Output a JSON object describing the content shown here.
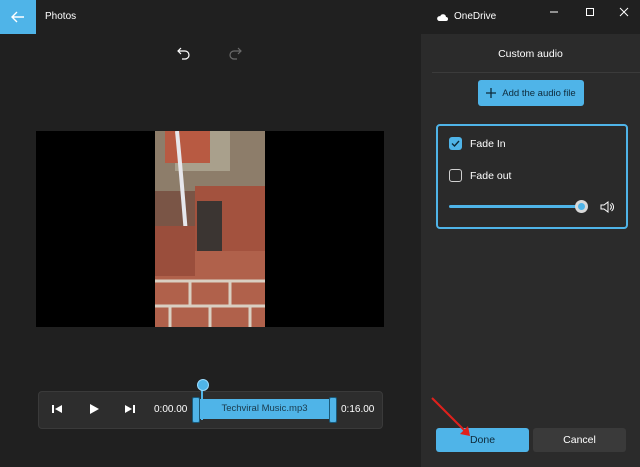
{
  "app": {
    "title": "Photos"
  },
  "titlebar": {
    "back_icon": "arrow-left-icon",
    "cloud_icon": "cloud-icon",
    "cloud_label": "OneDrive",
    "window_controls": [
      "minimize-icon",
      "maximize-icon",
      "close-icon"
    ]
  },
  "toolbar": {
    "undo_icon": "undo-icon",
    "redo_icon": "redo-icon"
  },
  "timeline": {
    "start_time": "0:00.00",
    "end_time": "0:16.00",
    "audio_track_label": "Techviral Music.mp3",
    "controls": [
      "skip-back-icon",
      "play-icon",
      "skip-forward-icon"
    ]
  },
  "panel": {
    "title": "Custom audio",
    "add_button_label": "Add the audio file",
    "fade_in_label": "Fade In",
    "fade_in_checked": true,
    "fade_out_label": "Fade out",
    "fade_out_checked": false,
    "volume_level": 1.0,
    "volume_icon": "speaker-icon"
  },
  "footer": {
    "done_label": "Done",
    "cancel_label": "Cancel"
  },
  "colors": {
    "accent": "#4fb4e8",
    "background": "#202020",
    "panel": "#2b2b2b"
  }
}
